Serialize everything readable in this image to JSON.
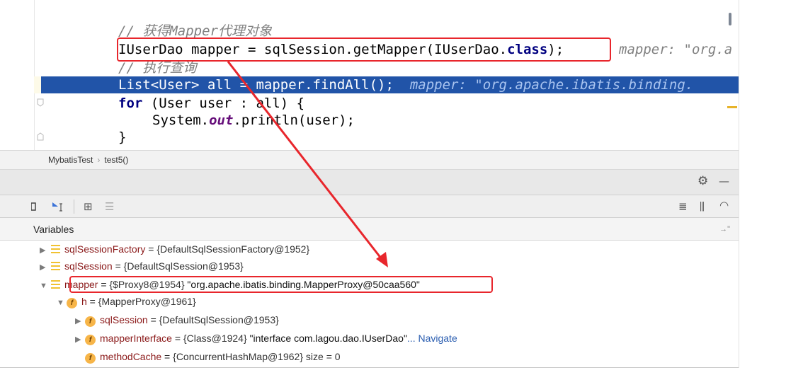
{
  "editor": {
    "lines": {
      "comment1": "// 获得Mapper代理对象",
      "line_mapper": {
        "type": "IUserDao",
        "rest1": " mapper = sqlSession.getMapper(IUserDao.",
        "keyword": "class",
        "rest2": ");",
        "hint_key": "mapper: ",
        "hint_val": "\"org.a"
      },
      "comment2": "// 执行查询",
      "line_all": {
        "code": "List<User> all = mapper.findAll();",
        "hint": "mapper: \"org.apache.ibatis.binding."
      },
      "line_for": {
        "keyword": "for",
        "rest": " (User user : all) {"
      },
      "line_println": {
        "pre": "System.",
        "field": "out",
        "post": ".println(user);"
      },
      "line_close": "}"
    }
  },
  "breadcrumb": {
    "class_name": "MybatisTest",
    "separator": "›",
    "method": "test5()"
  },
  "variables_panel": {
    "title": "Variables",
    "rows": [
      {
        "name": "sqlSessionFactory",
        "eq": " = ",
        "value": "{DefaultSqlSessionFactory@1952}",
        "expanded": false
      },
      {
        "name": "sqlSession",
        "eq": " = ",
        "value": "{DefaultSqlSession@1953}",
        "expanded": false
      },
      {
        "name": "mapper",
        "eq": " = ",
        "value": "{$Proxy8@1954} ",
        "str": "\"org.apache.ibatis.binding.MapperProxy@50caa560\"",
        "expanded": true
      },
      {
        "name": "h",
        "eq": " = ",
        "value": "{MapperProxy@1961}",
        "expanded": true
      },
      {
        "name": "sqlSession",
        "eq": " = ",
        "value": "{DefaultSqlSession@1953}",
        "expanded": false
      },
      {
        "name": "mapperInterface",
        "eq": " = ",
        "value": "{Class@1924} ",
        "str": "\"interface com.lagou.dao.IUserDao\"",
        "link": "... Navigate",
        "expanded": false
      },
      {
        "name": "methodCache",
        "eq": " = ",
        "value": "{ConcurrentHashMap@1962}",
        "extra": "  size = 0",
        "expanded": false
      }
    ]
  },
  "icons": {
    "gear": "⚙",
    "minimize": "—",
    "list_glyph": "≣",
    "columns_glyph": "⫼",
    "gauge_glyph": "◠",
    "table_glyph": "⊞",
    "frames_glyph": "☰"
  },
  "colors": {
    "exec_line": "#2154a8",
    "annotation_red": "#e8262c"
  }
}
